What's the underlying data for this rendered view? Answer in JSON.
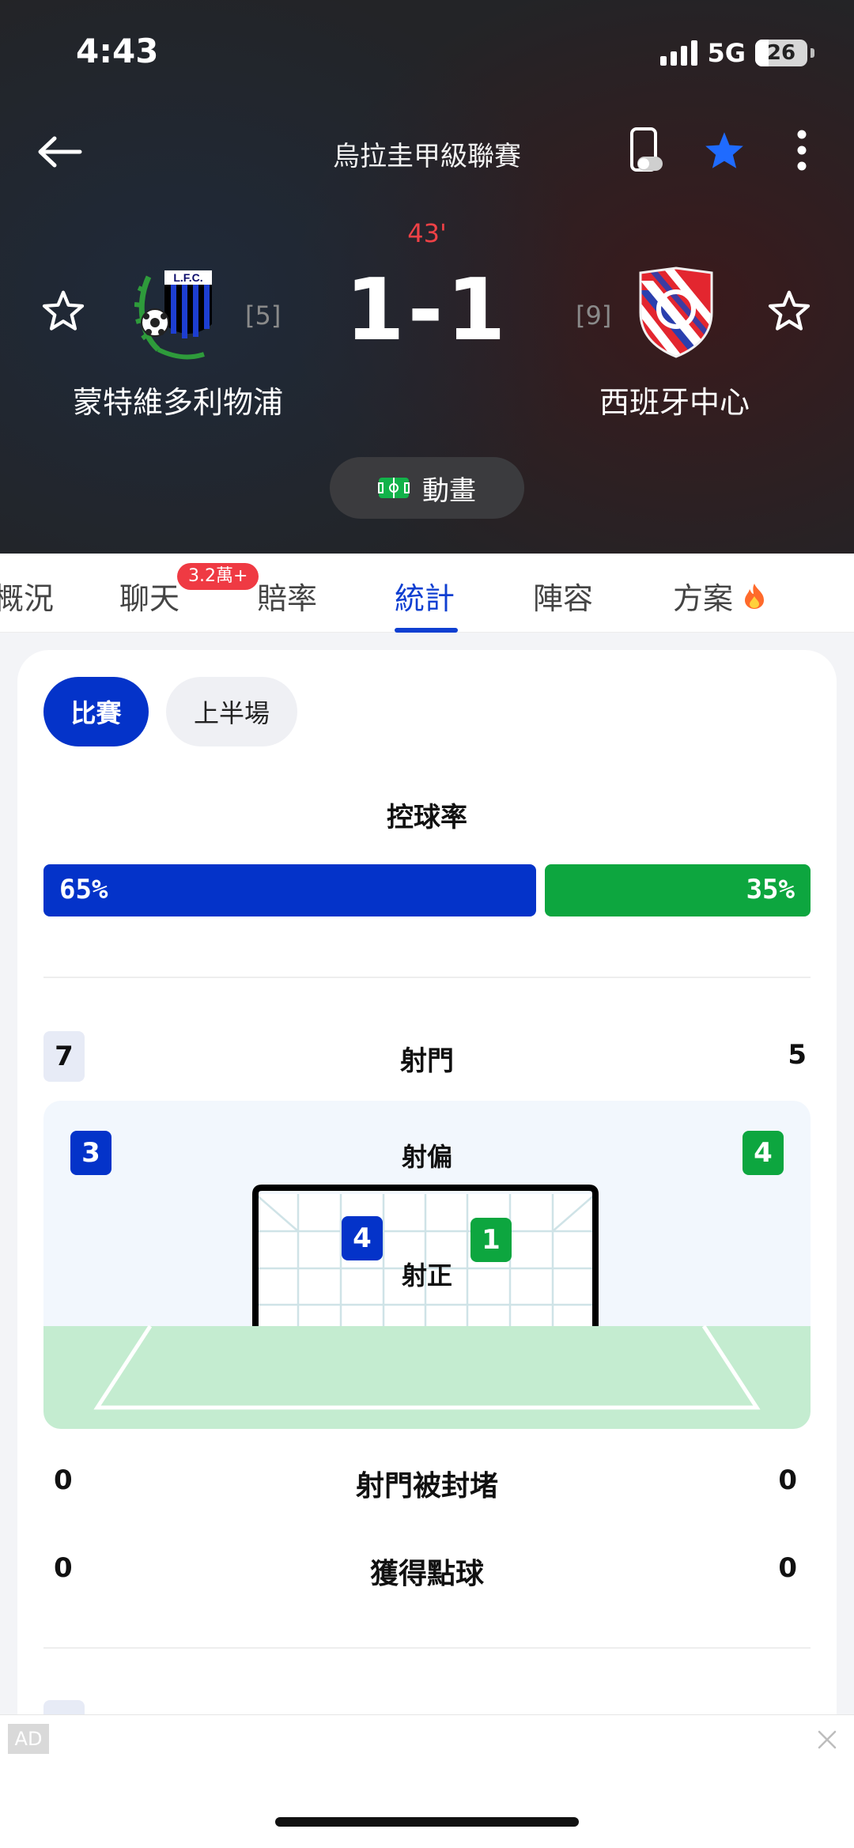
{
  "status_bar": {
    "time": "4:43",
    "network": "5G",
    "battery": "26"
  },
  "header": {
    "league": "烏拉圭甲級聯賽",
    "minute": "43'",
    "score": "1-1",
    "animation_label": "動畫",
    "home": {
      "name": "蒙特維多利物浦",
      "rank": "[5]",
      "logo_text": "L.F.C."
    },
    "away": {
      "name": "西班牙中心",
      "rank": "[9]"
    },
    "icons": [
      "back-arrow-icon",
      "phone-toggle-icon",
      "star-filled-icon",
      "more-vert-icon"
    ]
  },
  "tabs": {
    "items": [
      {
        "label": "概況"
      },
      {
        "label": "聊天"
      },
      {
        "label": "賠率"
      },
      {
        "label": "統計"
      },
      {
        "label": "陣容"
      },
      {
        "label": "方案"
      }
    ],
    "active": "統計",
    "chat_badge": "3.2萬+"
  },
  "stats": {
    "period_tabs": [
      "比賽",
      "上半場"
    ],
    "possession": {
      "title": "控球率",
      "home": "65%",
      "away": "35%",
      "home_value": 65,
      "away_value": 35
    },
    "shots": {
      "title": "射門",
      "home": "7",
      "away": "5"
    },
    "off_target": {
      "title": "射偏",
      "home": "3",
      "away": "4"
    },
    "on_target": {
      "title": "射正",
      "home": "4",
      "away": "1"
    },
    "blocked": {
      "title": "射門被封堵",
      "home": "0",
      "away": "0"
    },
    "penalties": {
      "title": "獲得點球",
      "home": "0",
      "away": "0"
    }
  },
  "ad": {
    "tag": "AD"
  },
  "colors": {
    "home": "#0433c9",
    "away": "#0da63f",
    "accent_red": "#ef4146",
    "active_tab": "#0f3fd1"
  }
}
